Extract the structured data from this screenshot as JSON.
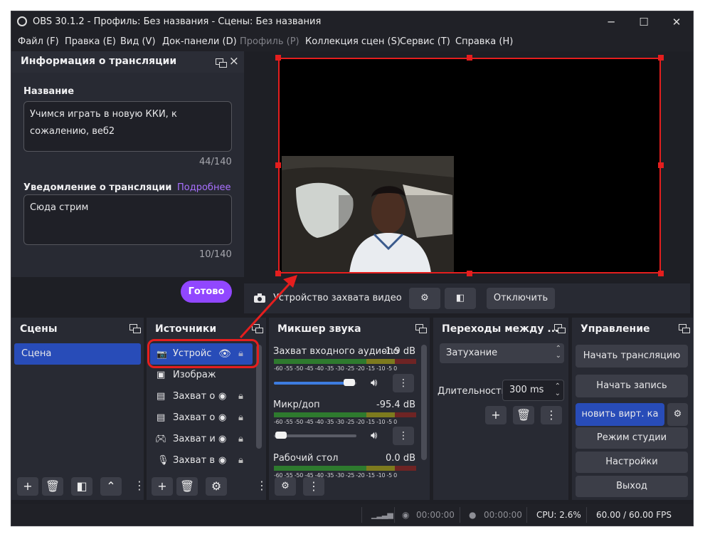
{
  "window": {
    "title": "OBS 30.1.2 - Профиль: Без названия - Сцены: Без названия",
    "minimize": "─",
    "maximize": "☐",
    "close": "✕"
  },
  "menu": [
    {
      "label": "Файл (F)",
      "disabled": false
    },
    {
      "label": "Правка (E)",
      "disabled": false
    },
    {
      "label": "Вид (V)",
      "disabled": false
    },
    {
      "label": "Док-панели (D)",
      "disabled": false
    },
    {
      "label": "Профиль (P)",
      "disabled": true
    },
    {
      "label": "Коллекция сцен (S)",
      "disabled": false
    },
    {
      "label": "Сервис (T)",
      "disabled": false
    },
    {
      "label": "Справка (H)",
      "disabled": false
    }
  ],
  "stream_info": {
    "title": "Информация о трансляции",
    "name_label": "Название",
    "name_value": "Учимся играть в новую ККИ, к сожалению, веб2",
    "name_counter": "44/140",
    "notify_label": "Уведомление о трансляции",
    "notify_link": "Подробнее",
    "notify_value": "Сюда стрим",
    "notify_counter": "10/140",
    "done_button": "Готово",
    "close": "×"
  },
  "source_toolbar": {
    "source_name": "Устройство захвата видео",
    "deactivate": "Отключить"
  },
  "scenes": {
    "title": "Сцены",
    "items": [
      "Сцена"
    ],
    "selected": 0
  },
  "sources": {
    "title": "Источники",
    "items": [
      {
        "label": "Устройс",
        "icon": "camera-icon",
        "visible": true,
        "locked": false
      },
      {
        "label": "Изображ",
        "icon": "image-icon",
        "visible": true,
        "locked": false
      },
      {
        "label": "Захват о",
        "icon": "window-icon",
        "visible": true,
        "locked": false
      },
      {
        "label": "Захват о",
        "icon": "window-icon",
        "visible": true,
        "locked": false
      },
      {
        "label": "Захват и",
        "icon": "gamepad-icon",
        "visible": true,
        "locked": false
      },
      {
        "label": "Захват в",
        "icon": "microphone-icon",
        "visible": true,
        "locked": false
      }
    ],
    "selected": 0
  },
  "mixer": {
    "title": "Микшер звука",
    "scale": "-60 -55 -50 -45 -40 -35 -30 -25 -20 -15 -10 -5  0",
    "channels": [
      {
        "name": "Захват входного аудиопо",
        "db": "-1.9 dB",
        "level": 0.76
      },
      {
        "name": "Микр/доп",
        "db": "-95.4 dB",
        "level": 0.06
      },
      {
        "name": "Рабочий стол",
        "db": "0.0 dB",
        "level": 0.0
      }
    ]
  },
  "transitions": {
    "title": "Переходы между ...",
    "current": "Затухание",
    "duration_label": "Длительность",
    "duration_value": "300 ms"
  },
  "controls": {
    "title": "Управление",
    "start_stream": "Начать трансляцию",
    "start_record": "Начать запись",
    "virtual_cam": "новить вирт. ка",
    "studio_mode": "Режим студии",
    "settings": "Настройки",
    "exit": "Выход"
  },
  "status": {
    "stream_time": "00:00:00",
    "record_time": "00:00:00",
    "cpu": "CPU: 2.6%",
    "fps": "60.00 / 60.00 FPS"
  },
  "colors": {
    "accent_purple": "#9147ff",
    "selection_blue": "#284cb8",
    "annotation_red": "#e51e1e"
  }
}
